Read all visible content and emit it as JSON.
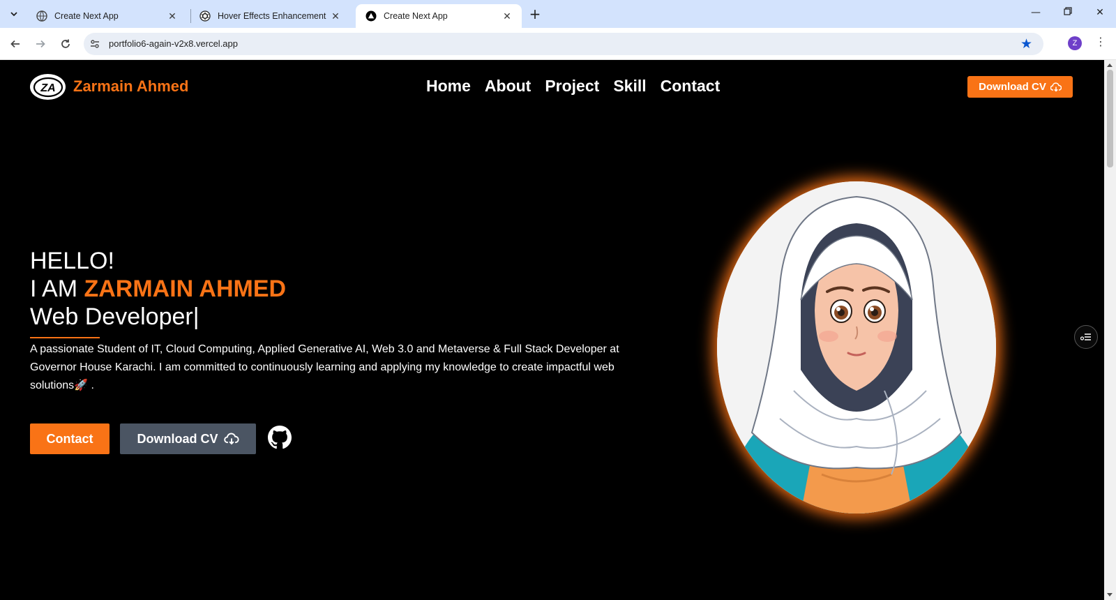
{
  "browser": {
    "tabs": [
      {
        "title": "Create Next App",
        "icon": "globe-icon"
      },
      {
        "title": "Hover Effects Enhancement",
        "icon": "openai-icon"
      },
      {
        "title": "Create Next App",
        "icon": "nextjs-triangle-icon",
        "active": true
      }
    ],
    "url": "portfolio6-again-v2x8.vercel.app",
    "profile_initial": "Z",
    "bookmarked": true
  },
  "site": {
    "brand": "Zarmain Ahmed",
    "logo_text": "ZA",
    "nav": [
      "Home",
      "About",
      "Project",
      "Skill",
      "Contact"
    ],
    "download_cv_label": "Download CV",
    "accent_color": "#f97316"
  },
  "hero": {
    "greeting": "HELLO!",
    "intro_prefix": "I AM",
    "name": "ZARMAIN AHMED",
    "role": "Web Developer|",
    "description": "A passionate Student of IT, Cloud Computing, Applied Generative AI, Web 3.0 and Metaverse & Full Stack Developer at Governor House Karachi. I am committed to continuously learning and applying my knowledge to create impactful web solutions🚀 .",
    "contact_label": "Contact",
    "download_label": "Download CV",
    "social_icon": "github-icon",
    "portrait": "cartoon-girl-hijab-portrait"
  }
}
